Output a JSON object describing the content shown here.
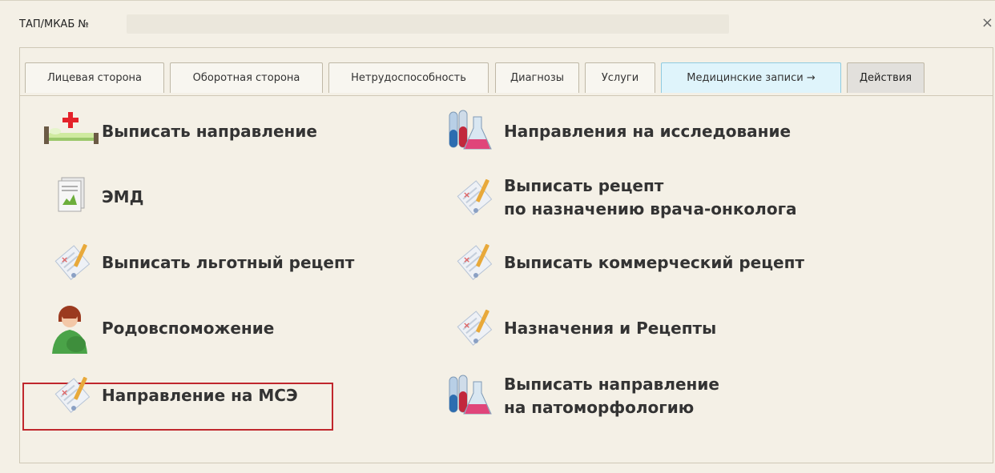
{
  "window": {
    "title": "ТАП/МКАБ №",
    "close_glyph": "×"
  },
  "tabs": [
    {
      "label": "Лицевая сторона"
    },
    {
      "label": "Оборотная сторона"
    },
    {
      "label": "Нетрудоспособность"
    },
    {
      "label": "Диагнозы"
    },
    {
      "label": "Услуги"
    },
    {
      "label": "Медицинские записи →"
    },
    {
      "label": "Действия"
    }
  ],
  "active_tab": "Действия",
  "actions": [
    {
      "label": "Выписать направление",
      "icon": "hospital-bed-icon"
    },
    {
      "label": "Направления на исследование",
      "icon": "lab-flasks-icon"
    },
    {
      "label": "ЭМД",
      "icon": "document-chart-icon"
    },
    {
      "label_line1": "Выписать рецепт",
      "label_line2": "по назначению врача-онколога",
      "icon": "prescription-icon"
    },
    {
      "label": "Выписать льготный рецепт",
      "icon": "prescription-icon"
    },
    {
      "label": "Выписать коммерческий рецепт",
      "icon": "prescription-icon"
    },
    {
      "label": "Родовспоможение",
      "icon": "pregnant-woman-icon"
    },
    {
      "label": "Назначения и Рецепты",
      "icon": "prescription-icon"
    },
    {
      "label": "Направление на МСЭ",
      "icon": "prescription-icon",
      "highlighted": true
    },
    {
      "label_line1": "Выписать направление",
      "label_line2": "на патоморфологию",
      "icon": "lab-flasks-icon"
    }
  ],
  "colors": {
    "background": "#f4f0e6",
    "highlight_border": "#c0272d",
    "med_tab_bg": "#dff4fb"
  }
}
